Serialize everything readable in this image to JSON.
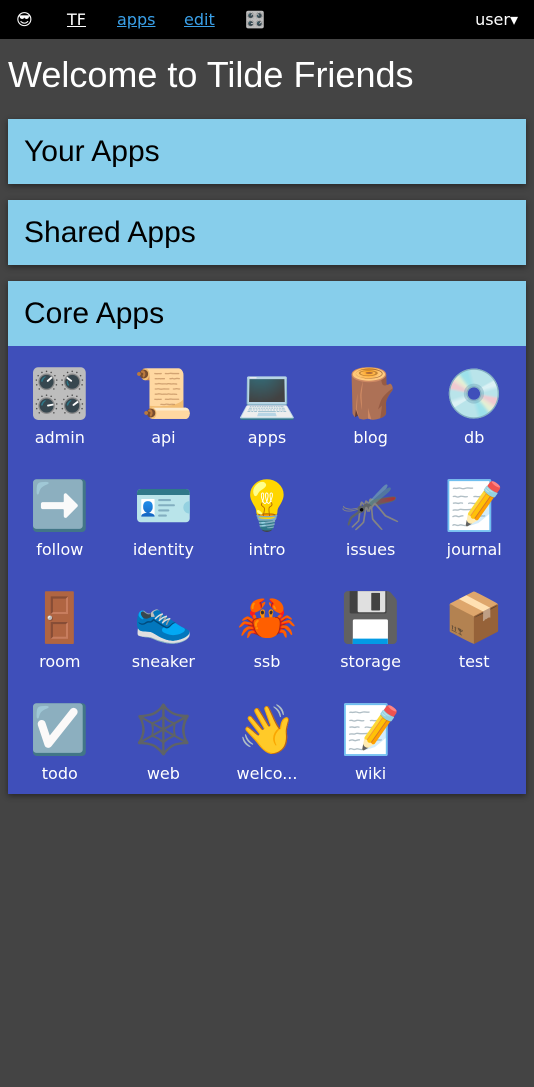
{
  "topbar": {
    "logo_icon": "😎",
    "logo_icon_name": "smiling-face-with-sunglasses-icon",
    "brand": "TF",
    "links": [
      "apps",
      "edit"
    ],
    "settings_icon": "🎛️",
    "settings_icon_name": "control-knobs-icon",
    "user_menu": "user▾",
    "link_color": "#3aa0e8"
  },
  "page": {
    "title": "Welcome to Tilde Friends"
  },
  "sections": {
    "your_apps": "Your Apps",
    "shared_apps": "Shared Apps",
    "core_apps": "Core Apps"
  },
  "colors": {
    "background": "#444444",
    "section_header": "#87ceeb",
    "grid_background": "#3f4fba"
  },
  "core_apps": [
    {
      "name": "admin",
      "icon": "🎛️",
      "icon_name": "control-knobs-icon"
    },
    {
      "name": "api",
      "icon": "📜",
      "icon_name": "scroll-icon"
    },
    {
      "name": "apps",
      "icon": "💻",
      "icon_name": "laptop-icon"
    },
    {
      "name": "blog",
      "icon": "🪵",
      "icon_name": "wood-log-icon"
    },
    {
      "name": "db",
      "icon": "💿",
      "icon_name": "optical-disc-icon"
    },
    {
      "name": "follow",
      "icon": "➡️",
      "icon_name": "right-arrow-icon"
    },
    {
      "name": "identity",
      "icon": "🪪",
      "icon_name": "id-card-icon"
    },
    {
      "name": "intro",
      "icon": "💡",
      "icon_name": "light-bulb-icon"
    },
    {
      "name": "issues",
      "icon": "🦟",
      "icon_name": "mosquito-icon"
    },
    {
      "name": "journal",
      "icon": "📝",
      "icon_name": "memo-icon"
    },
    {
      "name": "room",
      "icon": "🚪",
      "icon_name": "door-icon"
    },
    {
      "name": "sneaker",
      "icon": "👟",
      "icon_name": "sneaker-icon"
    },
    {
      "name": "ssb",
      "icon": "🦀",
      "icon_name": "crab-icon"
    },
    {
      "name": "storage",
      "icon": "💾",
      "icon_name": "floppy-disk-icon"
    },
    {
      "name": "test",
      "icon": "📦",
      "icon_name": "package-icon"
    },
    {
      "name": "todo",
      "icon": "☑️",
      "icon_name": "check-box-icon"
    },
    {
      "name": "web",
      "icon": "🕸️",
      "icon_name": "spider-web-icon"
    },
    {
      "name": "welco...",
      "icon": "👋",
      "icon_name": "waving-hand-icon"
    },
    {
      "name": "wiki",
      "icon": "📝",
      "icon_name": "memo-icon"
    }
  ]
}
